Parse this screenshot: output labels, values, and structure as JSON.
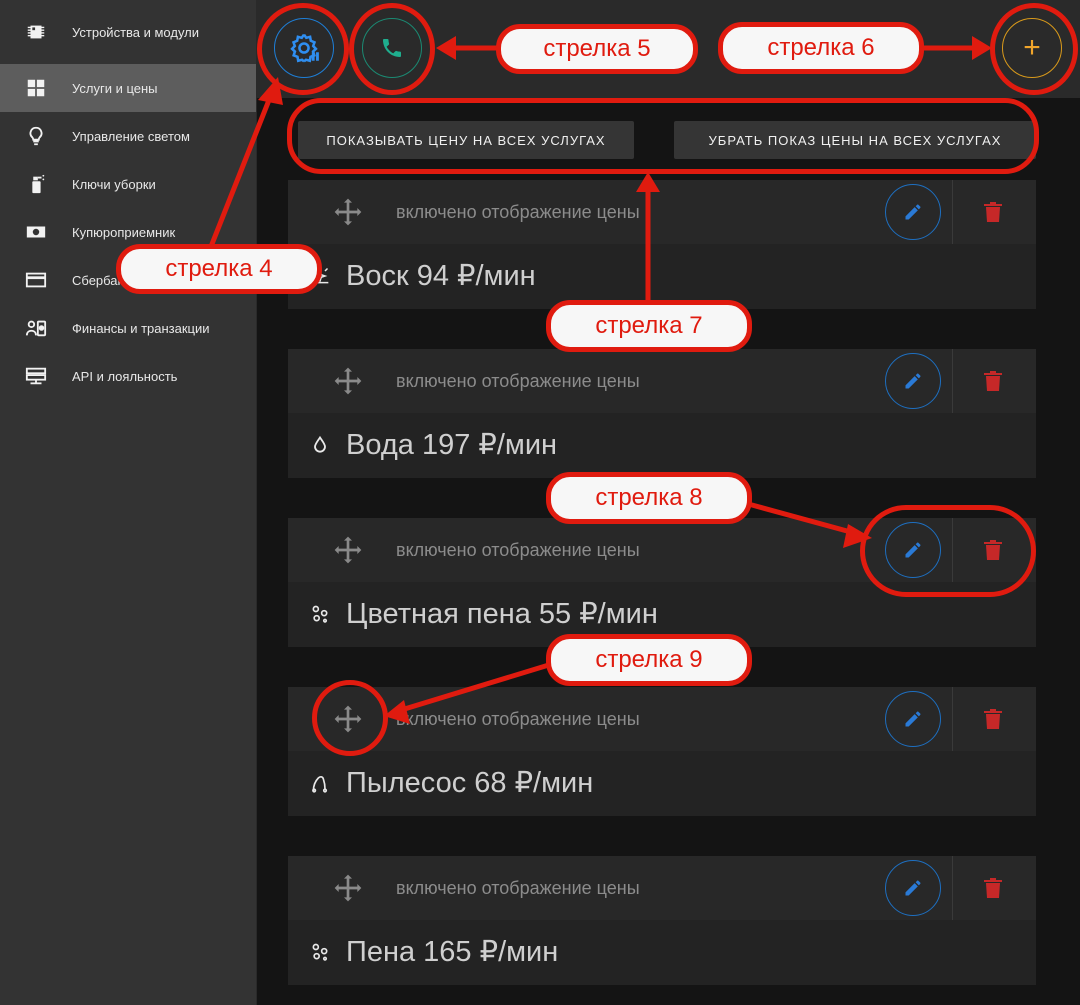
{
  "sidebar": {
    "items": [
      {
        "label": "Устройства и модули",
        "icon": "chip-icon"
      },
      {
        "label": "Услуги и цены",
        "icon": "grid-icon",
        "active": true
      },
      {
        "label": "Управление светом",
        "icon": "bulb-icon"
      },
      {
        "label": "Ключи уборки",
        "icon": "spray-icon"
      },
      {
        "label": "Купюроприемник",
        "icon": "banknote-icon"
      },
      {
        "label": "Сбербанк",
        "icon": "card-icon"
      },
      {
        "label": "Финансы и транзакции",
        "icon": "finance-icon"
      },
      {
        "label": "API и лояльность",
        "icon": "api-icon"
      }
    ]
  },
  "toolbar": {
    "add_label": "+"
  },
  "bulk": {
    "show_all": "Показывать цену на всех услугах",
    "hide_all": "Убрать показ цены на всех услугах"
  },
  "services": [
    {
      "title": "Воск 94 ₽/мин",
      "status": "включено отображение цены",
      "icon": "sparkle-icon"
    },
    {
      "title": "Вода 197 ₽/мин",
      "status": "включено отображение цены",
      "icon": "drop-icon"
    },
    {
      "title": "Цветная пена 55 ₽/мин",
      "status": "включено отображение цены",
      "icon": "bubbles-icon"
    },
    {
      "title": "Пылесос 68 ₽/мин",
      "status": "включено отображение цены",
      "icon": "vacuum-icon"
    },
    {
      "title": "Пена 165 ₽/мин",
      "status": "включено отображение цены",
      "icon": "bubbles-icon"
    }
  ],
  "annotations": {
    "arrow4": "стрелка 4",
    "arrow5": "стрелка 5",
    "arrow6": "стрелка 6",
    "arrow7": "стрелка 7",
    "arrow8": "стрелка 8",
    "arrow9": "стрелка 9"
  },
  "colors": {
    "accent_blue": "#1e7fd8",
    "accent_green": "#1b8a73",
    "accent_orange": "#f0a52b",
    "delete_red": "#c62828",
    "annotation_red": "#e01b0f"
  }
}
